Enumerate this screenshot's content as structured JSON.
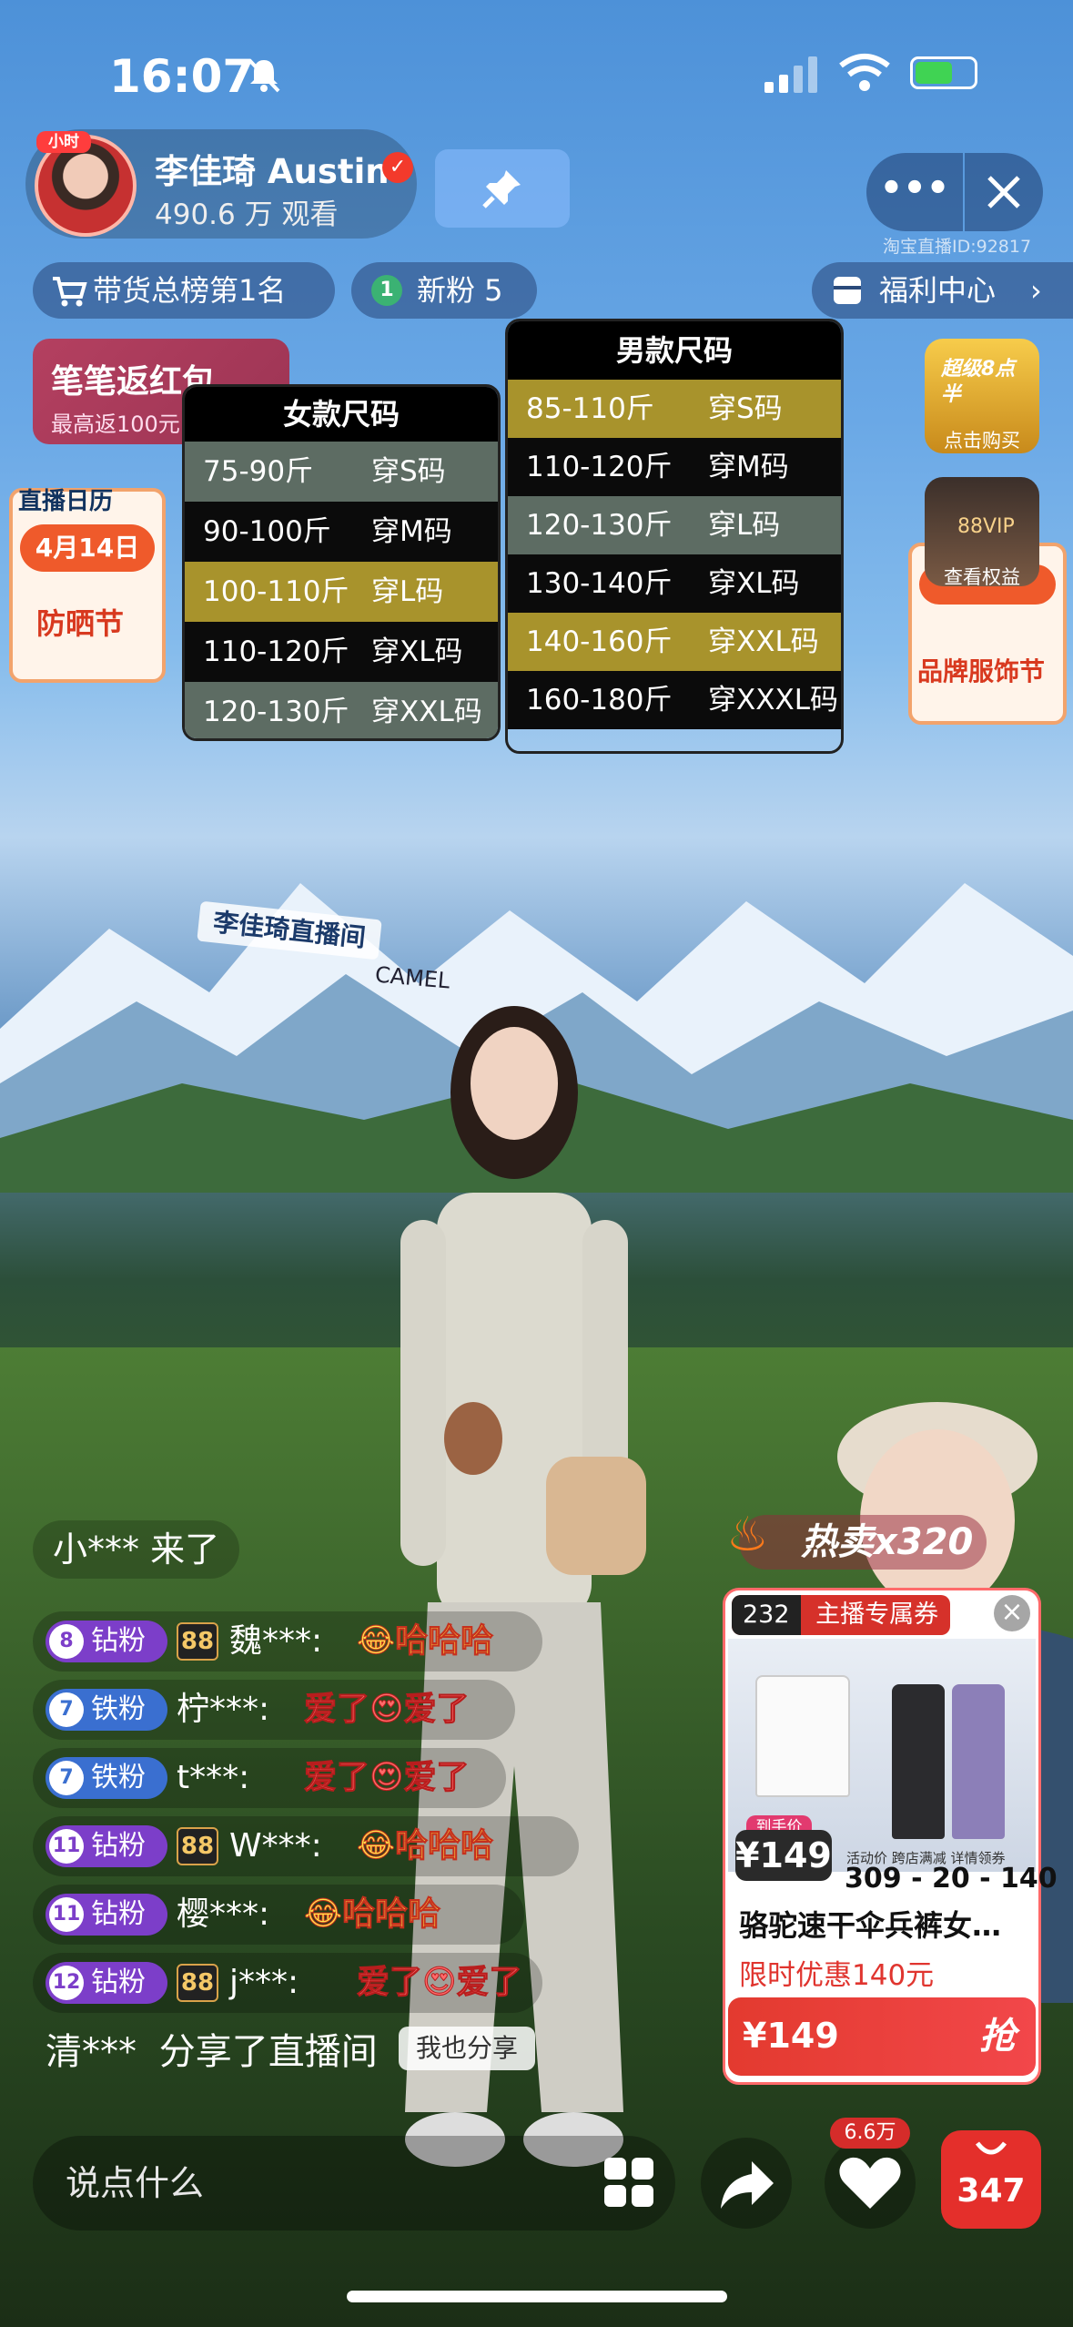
{
  "status": {
    "time": "16:07"
  },
  "host": {
    "avatar_tag": "小时",
    "name": "李佳琦 Austin",
    "viewers": "490.6 万 观看"
  },
  "room_id": "淘宝直播ID:92817",
  "chips": {
    "rank": "带货总榜第1名",
    "fans_num": "1",
    "fans": "新粉 5",
    "welfare": "福利中心"
  },
  "red_packet": {
    "title": "笔笔返红包",
    "subtitle": "最高返100元",
    "coin": "¥"
  },
  "women_chart": {
    "title": "女款尺码",
    "rows": [
      {
        "range": "75-90斤",
        "size": "穿S码",
        "color": "grey"
      },
      {
        "range": "90-100斤",
        "size": "穿M码",
        "color": "black"
      },
      {
        "range": "100-110斤",
        "size": "穿L码",
        "color": "olive"
      },
      {
        "range": "110-120斤",
        "size": "穿XL码",
        "color": "black"
      },
      {
        "range": "120-130斤",
        "size": "穿XXL码",
        "color": "grey"
      }
    ]
  },
  "men_chart": {
    "title": "男款尺码",
    "rows": [
      {
        "range": "85-110斤",
        "size": "穿S码",
        "color": "olive"
      },
      {
        "range": "110-120斤",
        "size": "穿M码",
        "color": "black"
      },
      {
        "range": "120-130斤",
        "size": "穿L码",
        "color": "grey"
      },
      {
        "range": "130-140斤",
        "size": "穿XL码",
        "color": "black"
      },
      {
        "range": "140-160斤",
        "size": "穿XXL码",
        "color": "olive"
      },
      {
        "range": "160-180斤",
        "size": "穿XXXL码",
        "color": "black"
      }
    ]
  },
  "calendar": {
    "head": "直播日历",
    "date": "4月14日",
    "event": "防晒节"
  },
  "brand_day": {
    "event": "品牌服饰节"
  },
  "promos": {
    "first": {
      "badge": "超级8点半",
      "label": "点击购买"
    },
    "second": {
      "badge": "88VIP",
      "label": "查看权益"
    }
  },
  "backdrop": {
    "logo": "李佳琦直播间",
    "brand": "CAMEL"
  },
  "hot_sale": "热卖x320",
  "chat": {
    "join": "小*** 来了",
    "messages": [
      {
        "num": "8",
        "badge": "钻粉",
        "tier": "dia",
        "has88": true,
        "user": "魏***:",
        "text": "😂哈哈哈",
        "kind": "laugh"
      },
      {
        "num": "7",
        "badge": "铁粉",
        "tier": "iron",
        "has88": false,
        "user": "柠***:",
        "text": "爱了😍爱了",
        "kind": "love"
      },
      {
        "num": "7",
        "badge": "铁粉",
        "tier": "iron",
        "has88": false,
        "user": "t***:",
        "text": "爱了😍爱了",
        "kind": "love"
      },
      {
        "num": "11",
        "badge": "钻粉",
        "tier": "dia",
        "has88": true,
        "user": "W***:",
        "text": "😂哈哈哈",
        "kind": "laugh"
      },
      {
        "num": "11",
        "badge": "钻粉",
        "tier": "dia",
        "has88": false,
        "user": "樱***:",
        "text": "😂哈哈哈",
        "kind": "laugh"
      },
      {
        "num": "12",
        "badge": "钻粉",
        "tier": "dia",
        "has88": true,
        "user": "j***:",
        "text": "爱了😍爱了",
        "kind": "love"
      }
    ],
    "badge88": "88",
    "share_user": "清***",
    "share_text": "分享了直播间",
    "share_button": "我也分享"
  },
  "product": {
    "coupon_num": "232",
    "coupon": "主播专属券",
    "price_label": "到手价",
    "price": "¥149",
    "stats_labels": "活动价  跨店满减  详情领券",
    "stats": "309 - 20 - 140",
    "title": "骆驼速干伞兵裤女…",
    "offer": "限时优惠140元",
    "buy_price": "¥149",
    "buy_button": "抢"
  },
  "bottom": {
    "comment_placeholder": "说点什么",
    "likes": "6.6万",
    "cart_count": "347"
  }
}
